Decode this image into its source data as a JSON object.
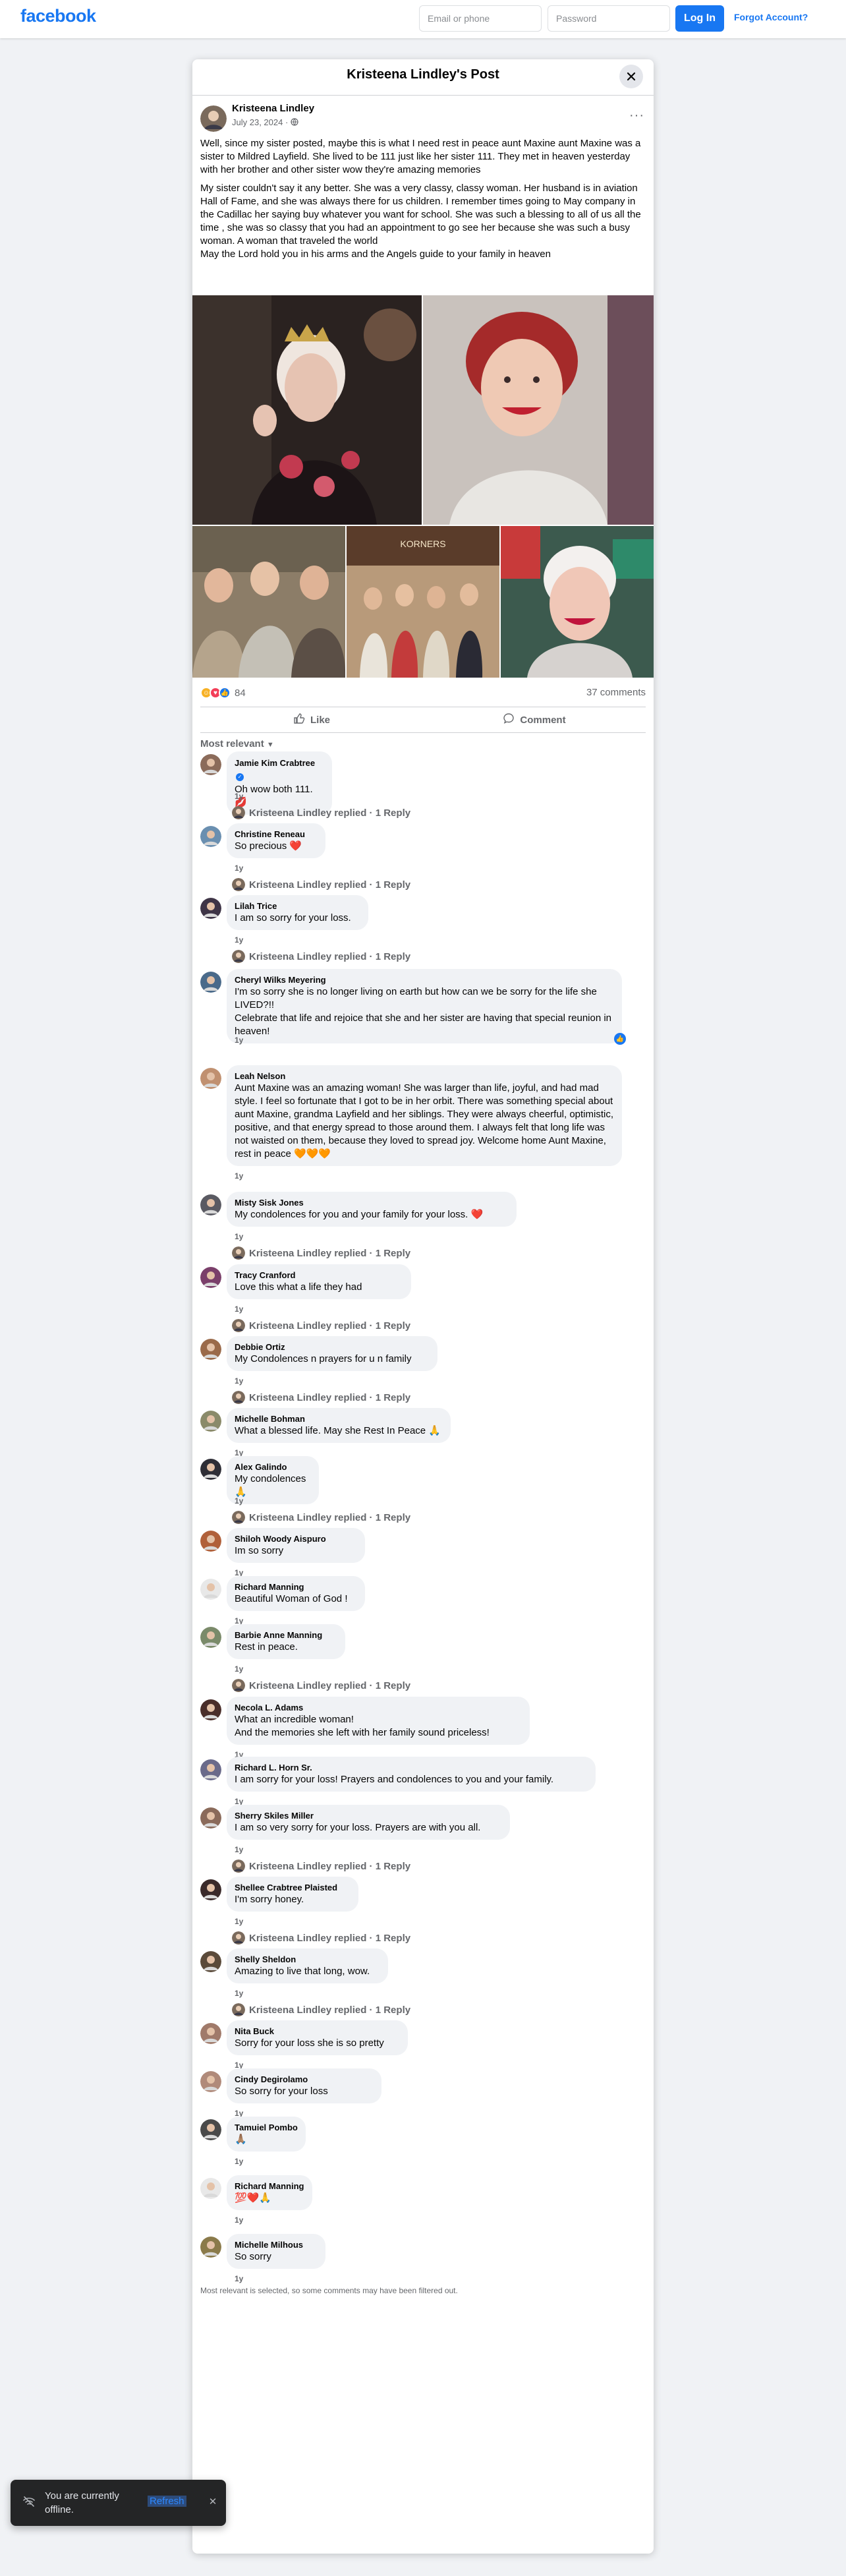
{
  "header": {
    "logo": "facebook",
    "email_placeholder": "Email or phone",
    "password_placeholder": "Password",
    "login_label": "Log In",
    "forgot_label": "Forgot Account?"
  },
  "post": {
    "dialog_title": "Kristeena Lindley's Post",
    "close_icon": "close-icon",
    "author": "Kristeena Lindley",
    "date": "July 23, 2024",
    "privacy_icon": "globe-icon",
    "more_label": "···",
    "paragraphs": [
      "Well, since my sister posted, maybe this is what I need rest in peace aunt Maxine aunt Maxine was a sister to Mildred Layfield. She lived to be 111 just like her sister 111. They met in heaven yesterday with her brother and other sister wow they're amazing memories",
      "My sister couldn't say it any better. She was a very classy, classy woman. Her husband is in aviation Hall of Fame, and she was always there for us children. I remember times going to May company in  the Cadillac her saying buy whatever you want for school. She was such a blessing to all of us all the time , she was so classy that you had an appointment to go see her because she was such a busy woman.  A woman that traveled the world\nMay the Lord hold you in his arms and the Angels guide to your family in heaven"
    ],
    "reaction_count": "84",
    "comment_count": "37 comments",
    "like_label": "Like",
    "comment_label": "Comment",
    "sort_label": "Most relevant",
    "photo_caption": "KORNERS"
  },
  "reply_author": "Kristeena Lindley",
  "comments": [
    {
      "name": "Jamie Kim Crabtree",
      "text": "Oh wow both 111. 💋",
      "time": "1y",
      "reply": "Kristeena Lindley replied · 1 Reply"
    },
    {
      "name": "Christine Reneau",
      "text": "So precious ❤️",
      "time": "1y",
      "reply": "Kristeena Lindley replied · 1 Reply"
    },
    {
      "name": "Lilah Trice",
      "text": "I am so sorry for your loss.",
      "time": "1y",
      "reply": "Kristeena Lindley replied · 1 Reply"
    },
    {
      "name": "Cheryl Wilks Meyering",
      "text": "I'm so sorry she is no longer living on earth but how can we be sorry for the life she LIVED?!!\nCelebrate that life and rejoice that she and her sister are having that special reunion in heaven!",
      "time": "1y",
      "reply": ""
    },
    {
      "name": "Leah Nelson",
      "text": "Aunt Maxine was an amazing woman! She was larger than life, joyful, and had mad style. I feel so fortunate that I got to be in her orbit. There was something special about aunt Maxine, grandma Layfield and her siblings. They were always cheerful, optimistic, positive, and that energy spread to those around them. I always felt that long life was not waisted on them, because they loved to spread joy. Welcome home Aunt Maxine, rest in peace 🧡🧡🧡",
      "time": "1y",
      "reply": ""
    },
    {
      "name": "Misty Sisk Jones",
      "text": "My condolences for you and your family for your loss. ❤️",
      "time": "1y",
      "reply": "Kristeena Lindley replied · 1 Reply"
    },
    {
      "name": "Tracy Cranford",
      "text": "Love this what a life they had",
      "time": "1y",
      "reply": "Kristeena Lindley replied · 1 Reply"
    },
    {
      "name": "Debbie Ortiz",
      "text": "My Condolences n prayers for u n family",
      "time": "1y",
      "reply": "Kristeena Lindley replied · 1 Reply"
    },
    {
      "name": "Michelle Bohman",
      "text": "What a blessed life. May she Rest In Peace 🙏",
      "time": "1y",
      "reply": ""
    },
    {
      "name": "Alex Galindo",
      "text": "My condolences 🙏",
      "time": "1y",
      "reply": "Kristeena Lindley replied · 1 Reply"
    },
    {
      "name": "Shiloh Woody Aispuro",
      "text": "Im so sorry",
      "time": "1y",
      "reply": ""
    },
    {
      "name": "Richard Manning",
      "text": "Beautiful Woman of God !",
      "time": "1y",
      "reply": ""
    },
    {
      "name": "Barbie Anne Manning",
      "text": "Rest in peace.",
      "time": "1y",
      "reply": "Kristeena Lindley replied · 1 Reply"
    },
    {
      "name": "Necola L. Adams",
      "text": "What an incredible woman!\nAnd the memories she left with her family sound priceless!",
      "time": "1y",
      "reply": ""
    },
    {
      "name": "Richard L. Horn Sr.",
      "text": "I am sorry for your loss! Prayers and condolences to you and your family.",
      "time": "1y",
      "reply": ""
    },
    {
      "name": "Sherry Skiles Miller",
      "text": "I am so very sorry for your loss. Prayers are with you all.",
      "time": "1y",
      "reply": "Kristeena Lindley replied · 1 Reply"
    },
    {
      "name": "Shellee Crabtree Plaisted",
      "text": "I'm sorry honey.",
      "time": "1y",
      "reply": "Kristeena Lindley replied · 1 Reply"
    },
    {
      "name": "Shelly Sheldon",
      "text": "Amazing to live that long, wow.",
      "time": "1y",
      "reply": "Kristeena Lindley replied · 1 Reply"
    },
    {
      "name": "Nita Buck",
      "text": "Sorry for your loss she is so pretty",
      "time": "1y",
      "reply": ""
    },
    {
      "name": "Cindy Degirolamo",
      "text": "So sorry for your loss",
      "time": "1y",
      "reply": ""
    },
    {
      "name": "Tamuiel Pombo",
      "text": "🙏🏽",
      "time": "1y",
      "reply": ""
    },
    {
      "name": "Richard Manning",
      "text": "💯❤️🙏",
      "time": "1y",
      "reply": ""
    },
    {
      "name": "Michelle Milhous",
      "text": "So sorry",
      "time": "1y",
      "reply": ""
    }
  ],
  "footer_note": "Most relevant is selected, so some comments may have been filtered out.",
  "toast": {
    "text": "You are currently offline.",
    "refresh_label": "Refresh",
    "icon": "wifi-off-icon",
    "close_icon": "close-icon"
  }
}
